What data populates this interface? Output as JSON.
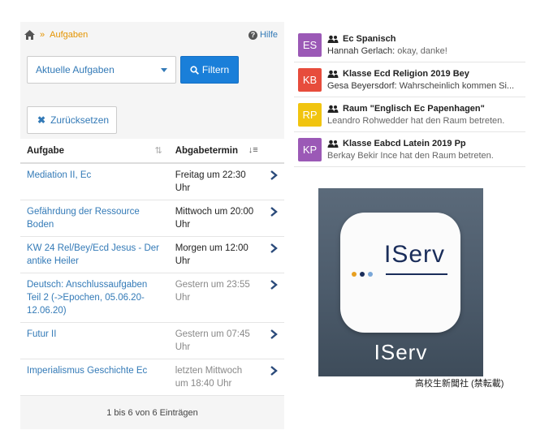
{
  "breadcrumb": {
    "current": "Aufgaben",
    "separator": "»",
    "help": "Hilfe"
  },
  "filter": {
    "select_value": "Aktuelle Aufgaben",
    "filter_button": "Filtern",
    "reset_button": "Zurücksetzen"
  },
  "table": {
    "headers": [
      "Aufgabe",
      "Abgabetermin"
    ],
    "rows": [
      {
        "name": "Mediation II, Ec",
        "due": "Freitag um 22:30 Uhr",
        "past": false
      },
      {
        "name": "Gefährdung der Ressource Boden",
        "due": "Mittwoch um 20:00 Uhr",
        "past": false
      },
      {
        "name": "KW 24 Rel/Bey/Ecd Jesus - Der antike Heiler",
        "due": "Morgen um 12:00 Uhr",
        "past": false
      },
      {
        "name": "Deutsch: Anschlussaufgaben Teil 2 (->Epochen, 05.06.20-12.06.20)",
        "due": "Gestern um 23:55 Uhr",
        "past": true
      },
      {
        "name": "Futur II",
        "due": "Gestern um 07:45 Uhr",
        "past": true
      },
      {
        "name": "Imperialismus Geschichte Ec",
        "due": "letzten Mittwoch um 18:40 Uhr",
        "past": true
      }
    ],
    "pager": "1 bis 6 von 6 Einträgen"
  },
  "chats": [
    {
      "initials": "ES",
      "color": "#9b59b6",
      "title": "Ec Spanisch",
      "sender": "Hannah Gerlach:",
      "message": "okay, danke!"
    },
    {
      "initials": "KB",
      "color": "#e74c3c",
      "title": "Klasse Ecd Religion 2019 Bey",
      "sender": "Gesa Beyersdorf:",
      "message": "Wahrscheinlich kommen Si..."
    },
    {
      "initials": "RP",
      "color": "#f1c40f",
      "title": "Raum \"Englisch Ec Papenhagen\"",
      "sender": "",
      "message": "Leandro Rohwedder hat den Raum betreten."
    },
    {
      "initials": "KP",
      "color": "#9b59b6",
      "title": "Klasse Eabcd Latein 2019 Pp",
      "sender": "",
      "message": "Berkay Bekir Ince hat den Raum betreten."
    }
  ],
  "app": {
    "icon_text": "IServ",
    "label": "IServ",
    "dot_colors": [
      "#e8a020",
      "#1a2d5a",
      "#7aa7d8"
    ]
  },
  "credit": "高校生新聞社 (禁転載)",
  "colors": {
    "link": "#337ab7",
    "primary": "#1a7fd9",
    "breadcrumb": "#e59400"
  }
}
